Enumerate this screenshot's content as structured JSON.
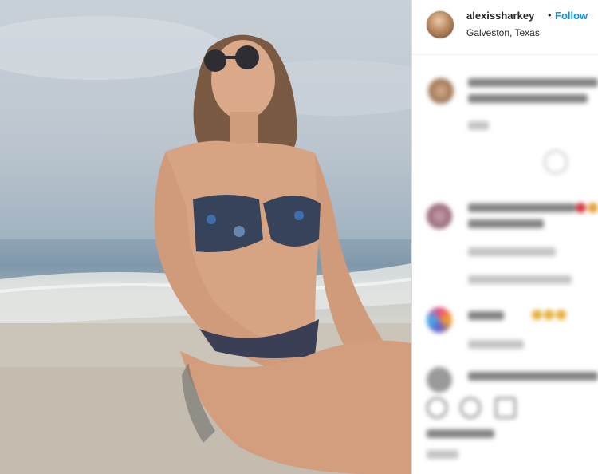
{
  "post": {
    "username": "alexissharkey",
    "separator": "•",
    "follow_label": "Follow",
    "location": "Galveston, Texas"
  },
  "colors": {
    "follow_accent": "#0095f6",
    "text": "#262626",
    "divider": "#dbdbdb"
  },
  "icons": [
    "more-options-icon",
    "heart-icon",
    "comment-icon",
    "share-icon"
  ]
}
